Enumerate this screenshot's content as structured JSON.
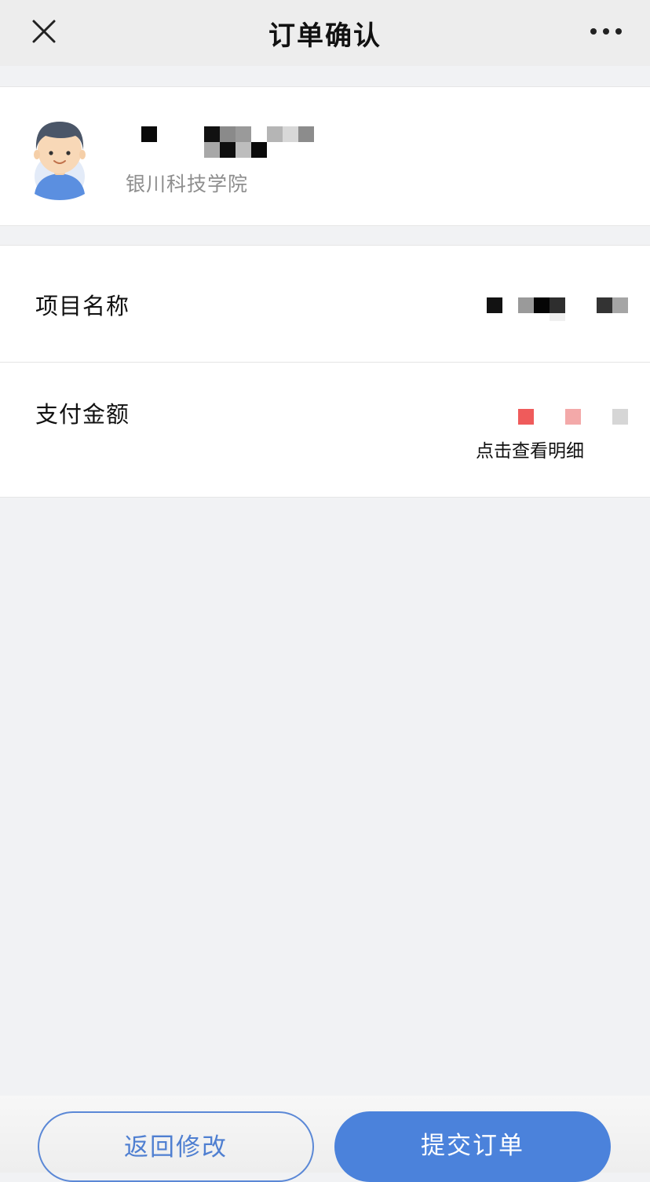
{
  "nav": {
    "title": "订单确认",
    "close_icon": "close-icon",
    "more_icon": "more-icon"
  },
  "user": {
    "school": "银川科技学院",
    "name_obscured": true,
    "avatar_icon": "avatar"
  },
  "order": {
    "project_label": "项目名称",
    "amount_label": "支付金额",
    "detail_link": "点击查看明细",
    "project_value_obscured": true,
    "amount_value_obscured": true
  },
  "actions": {
    "back_label": "返回修改",
    "submit_label": "提交订单"
  },
  "colors": {
    "primary": "#4b82db",
    "secondary_text": "#8e8e8e",
    "page_bg": "#f1f2f4",
    "amount_red": "#ef5b5b"
  }
}
